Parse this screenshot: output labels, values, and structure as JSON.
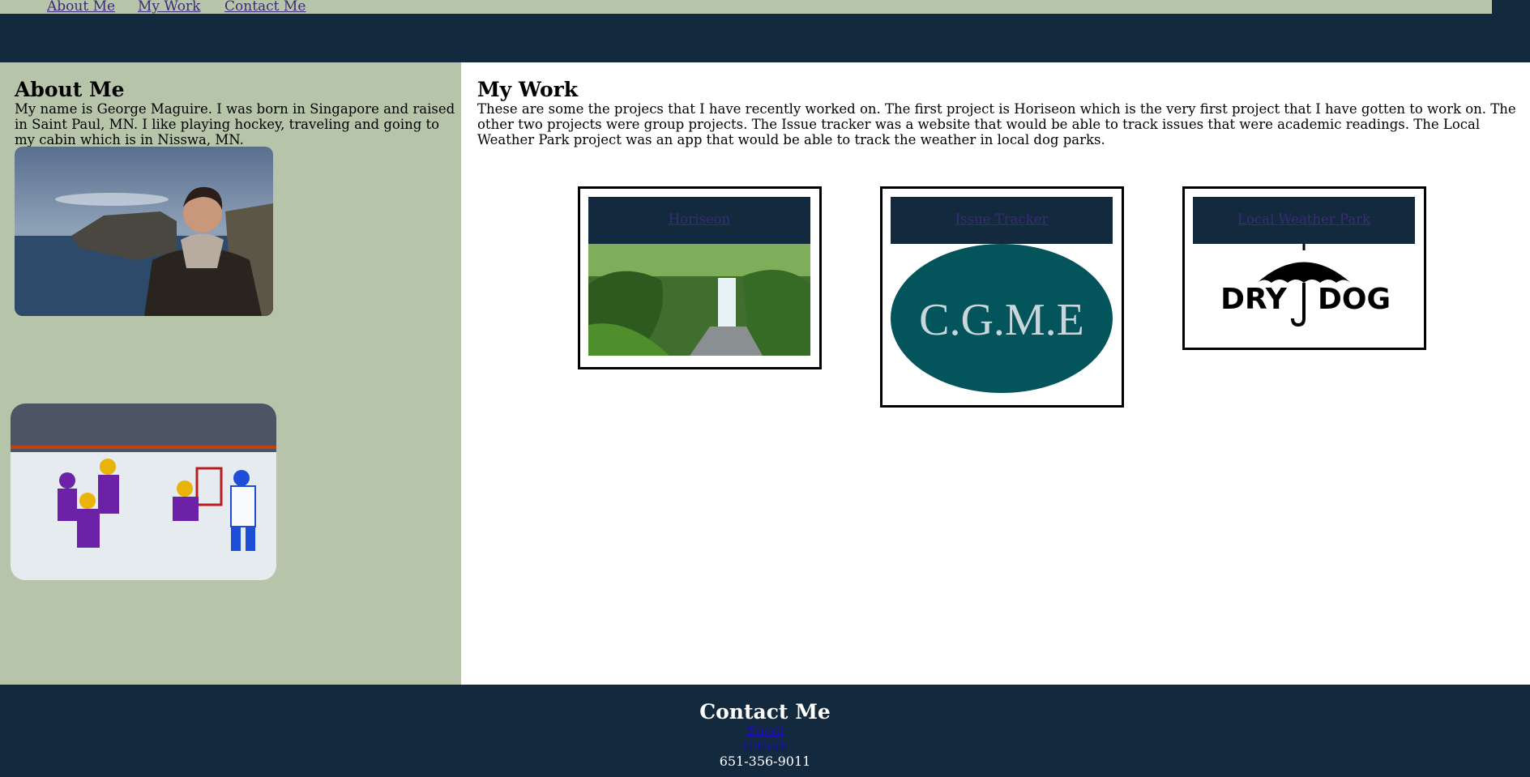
{
  "nav": {
    "items": [
      {
        "label": "About Me"
      },
      {
        "label": "My Work"
      },
      {
        "label": "Contact Me"
      }
    ]
  },
  "about": {
    "heading": "About Me",
    "text": "My name is George Maguire. I was born in Singapore and raised in Saint Paul, MN. I like playing hockey, traveling and going to my cabin which is in Nisswa, MN."
  },
  "work": {
    "heading": "My Work",
    "text": "These are some the projecs that I have recently worked on. The first project is Horiseon which is the very first project that I have gotten to work on. The other two projects were group projects. The Issue tracker was a website that would be able to track issues that were academic readings. The Local Weather Park project was an app that would be able to track the weather in local dog parks.",
    "projects": [
      {
        "label": "Horiseon"
      },
      {
        "label": "Issue Tracker",
        "logo_text": "C.G.M.E"
      },
      {
        "label": "Local Weather Park",
        "logo_left": "DRY",
        "logo_right": "DOG"
      }
    ]
  },
  "contact": {
    "heading": "Contact Me",
    "email_label": "Email",
    "github_label": "Github",
    "phone": "651-356-9011"
  },
  "colors": {
    "navy": "#13293d",
    "sage": "#b6c5aa",
    "teal": "#04545c"
  }
}
